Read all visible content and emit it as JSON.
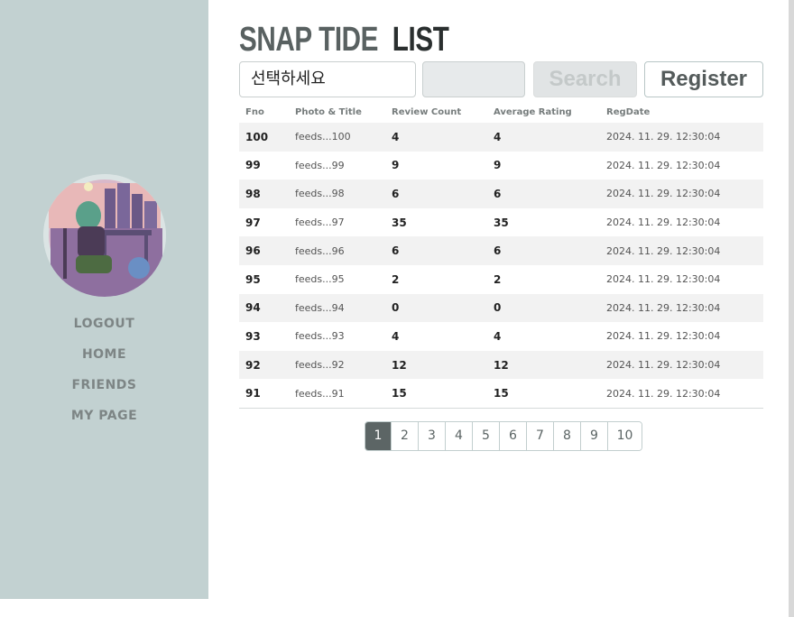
{
  "title": {
    "part1": "SNAP TIDE",
    "part2": "LIST"
  },
  "nav": [
    "LOGOUT",
    "HOME",
    "FRIENDS",
    "MY PAGE"
  ],
  "search": {
    "select_value": "선택하세요",
    "keyword_value": "",
    "search_label": "Search",
    "register_label": "Register"
  },
  "table": {
    "headers": [
      "Fno",
      "Photo & Title",
      "Review Count",
      "Average Rating",
      "RegDate"
    ],
    "rows": [
      {
        "fno": "100",
        "title": "feeds...100",
        "review": "4",
        "rating": "4",
        "date": "2024. 11. 29. 12:30:04"
      },
      {
        "fno": "99",
        "title": "feeds...99",
        "review": "9",
        "rating": "9",
        "date": "2024. 11. 29. 12:30:04"
      },
      {
        "fno": "98",
        "title": "feeds...98",
        "review": "6",
        "rating": "6",
        "date": "2024. 11. 29. 12:30:04"
      },
      {
        "fno": "97",
        "title": "feeds...97",
        "review": "35",
        "rating": "35",
        "date": "2024. 11. 29. 12:30:04"
      },
      {
        "fno": "96",
        "title": "feeds...96",
        "review": "6",
        "rating": "6",
        "date": "2024. 11. 29. 12:30:04"
      },
      {
        "fno": "95",
        "title": "feeds...95",
        "review": "2",
        "rating": "2",
        "date": "2024. 11. 29. 12:30:04"
      },
      {
        "fno": "94",
        "title": "feeds...94",
        "review": "0",
        "rating": "0",
        "date": "2024. 11. 29. 12:30:04"
      },
      {
        "fno": "93",
        "title": "feeds...93",
        "review": "4",
        "rating": "4",
        "date": "2024. 11. 29. 12:30:04"
      },
      {
        "fno": "92",
        "title": "feeds...92",
        "review": "12",
        "rating": "12",
        "date": "2024. 11. 29. 12:30:04"
      },
      {
        "fno": "91",
        "title": "feeds...91",
        "review": "15",
        "rating": "15",
        "date": "2024. 11. 29. 12:30:04"
      }
    ]
  },
  "pagination": {
    "pages": [
      "1",
      "2",
      "3",
      "4",
      "5",
      "6",
      "7",
      "8",
      "9",
      "10"
    ],
    "active": "1"
  },
  "colors": {
    "sidebar": "#c2d1d1",
    "accent": "#5c6565"
  }
}
